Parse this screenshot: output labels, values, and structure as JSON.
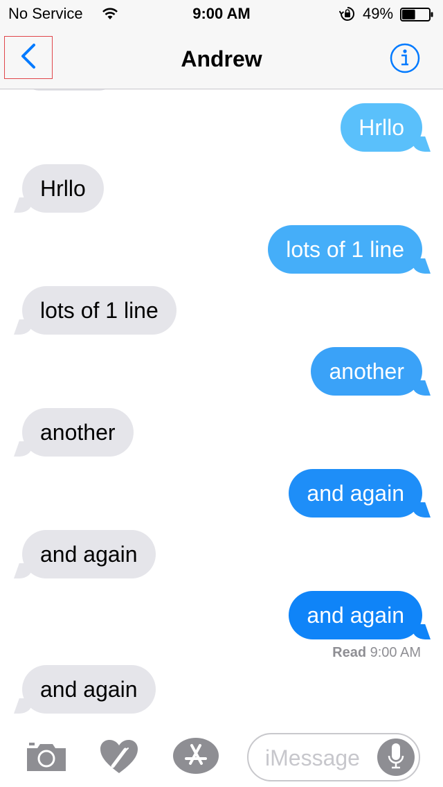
{
  "status_bar": {
    "carrier": "No Service",
    "time": "9:00 AM",
    "battery_percent": "49%",
    "battery_level": 0.49,
    "icons": [
      "wifi-icon",
      "rotation-lock-icon",
      "battery-icon"
    ]
  },
  "nav": {
    "title": "Andrew",
    "back_icon": "chevron-left-icon",
    "info_icon": "info-icon"
  },
  "messages": [
    {
      "direction": "outgoing",
      "text": "Hrllo",
      "color": "#5ac0fb"
    },
    {
      "direction": "incoming",
      "text": "Hrllo"
    },
    {
      "direction": "outgoing",
      "text": "lots of 1 line",
      "color": "#45aef9"
    },
    {
      "direction": "incoming",
      "text": "lots of 1 line"
    },
    {
      "direction": "outgoing",
      "text": "another",
      "color": "#3aa2f8"
    },
    {
      "direction": "incoming",
      "text": "another"
    },
    {
      "direction": "outgoing",
      "text": "and again",
      "color": "#1e8ef8"
    },
    {
      "direction": "incoming",
      "text": "and again"
    },
    {
      "direction": "outgoing",
      "text": "and again",
      "color": "#0f84f8"
    },
    {
      "direction": "incoming",
      "text": "and again"
    }
  ],
  "receipt": {
    "label": "Read",
    "time": "9:00 AM"
  },
  "input_bar": {
    "placeholder": "iMessage",
    "tools": [
      "camera-icon",
      "digital-touch-icon",
      "app-store-icon"
    ],
    "mic_icon": "microphone-icon"
  },
  "colors": {
    "accent": "#007aff",
    "incoming_bubble": "#e5e5ea",
    "tool_icon": "#8e8e93"
  }
}
